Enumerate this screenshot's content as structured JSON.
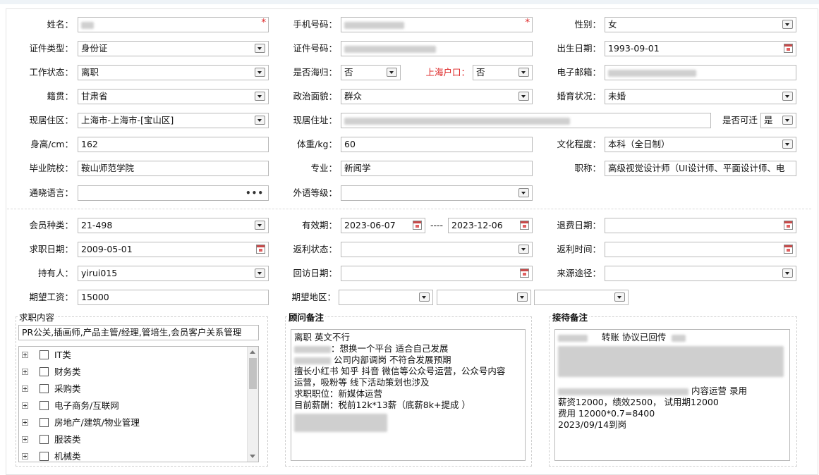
{
  "fields": {
    "name": {
      "label": "姓名："
    },
    "phone": {
      "label": "手机号码："
    },
    "gender": {
      "label": "性别：",
      "value": "女"
    },
    "id_type": {
      "label": "证件类型：",
      "value": "身份证"
    },
    "id_no": {
      "label": "证件号码："
    },
    "birth": {
      "label": "出生日期：",
      "value": "1993-09-01"
    },
    "work_status": {
      "label": "工作状态：",
      "value": "离职"
    },
    "returnee": {
      "label": "是否海归：",
      "value": "否"
    },
    "sh_hukou": {
      "label": "上海户口：",
      "value": "否"
    },
    "email": {
      "label": "电子邮箱："
    },
    "native": {
      "label": "籍贯：",
      "value": "甘肃省"
    },
    "political": {
      "label": "政治面貌：",
      "value": "群众"
    },
    "marital": {
      "label": "婚育状况：",
      "value": "未婚"
    },
    "district": {
      "label": "现居住区：",
      "value": "上海市-上海市-[宝山区]"
    },
    "address": {
      "label": "现居住址："
    },
    "movable": {
      "label": "是否可迁",
      "value": "是"
    },
    "height": {
      "label": "身高/cm：",
      "value": "162"
    },
    "weight": {
      "label": "体重/kg：",
      "value": "60"
    },
    "education": {
      "label": "文化程度：",
      "value": "本科（全日制）"
    },
    "school": {
      "label": "毕业院校：",
      "value": "鞍山师范学院"
    },
    "major": {
      "label": "专业：",
      "value": "新闻学"
    },
    "title": {
      "label": "职称：",
      "value": "高级视觉设计师（UI设计师、平面设计师、电"
    },
    "languages": {
      "label": "通晓语言："
    },
    "lang_level": {
      "label": "外语等级："
    },
    "member_type": {
      "label": "会员种类：",
      "value": "21-498"
    },
    "validity": {
      "label": "有效期：",
      "start": "2023-06-07",
      "sep": "----",
      "end": "2023-12-06"
    },
    "refund_date": {
      "label": "退费日期："
    },
    "job_date": {
      "label": "求职日期：",
      "value": "2009-05-01"
    },
    "rebate_status": {
      "label": "返利状态："
    },
    "rebate_time": {
      "label": "返利时间："
    },
    "holder": {
      "label": "持有人：",
      "value": "yirui015"
    },
    "visit_date": {
      "label": "回访日期："
    },
    "source": {
      "label": "来源途径："
    },
    "salary": {
      "label": "期望工资：",
      "value": "15000"
    },
    "region": {
      "label": "期望地区："
    }
  },
  "job_content": {
    "legend": "求职内容",
    "summary": "PR公关,插画师,产品主管/经理,管培生,会员客户关系管理",
    "tree": [
      "IT类",
      "财务类",
      "采购类",
      "电子商务/互联网",
      "房地产/建筑/物业管理",
      "服装类",
      "机械类"
    ]
  },
  "consultant_notes": {
    "legend": "顾问备注",
    "lines": [
      "离职  英文不行",
      "：想换一个平台 适合自己发展",
      " 公司内部调岗 不符合发展预期",
      "擅长小红书 知乎 抖音 微信等公众号运营，公众号内容",
      "运营，吸粉等 线下活动策划也涉及",
      "求职职位：新媒体运营",
      "目前薪酬：税前12k*13薪（底薪8k+提成 ）"
    ]
  },
  "reception_notes": {
    "legend": "接待备注",
    "line1": "转账   协议已回传",
    "line2": "内容运营   录用",
    "line3": "薪资12000，绩效2500，  试用期12000",
    "line4": "费用 12000*0.7=8400",
    "line5": "2023/09/14到岗"
  },
  "colors": {
    "required": "#dd2222",
    "border": "#b9b9b9"
  }
}
